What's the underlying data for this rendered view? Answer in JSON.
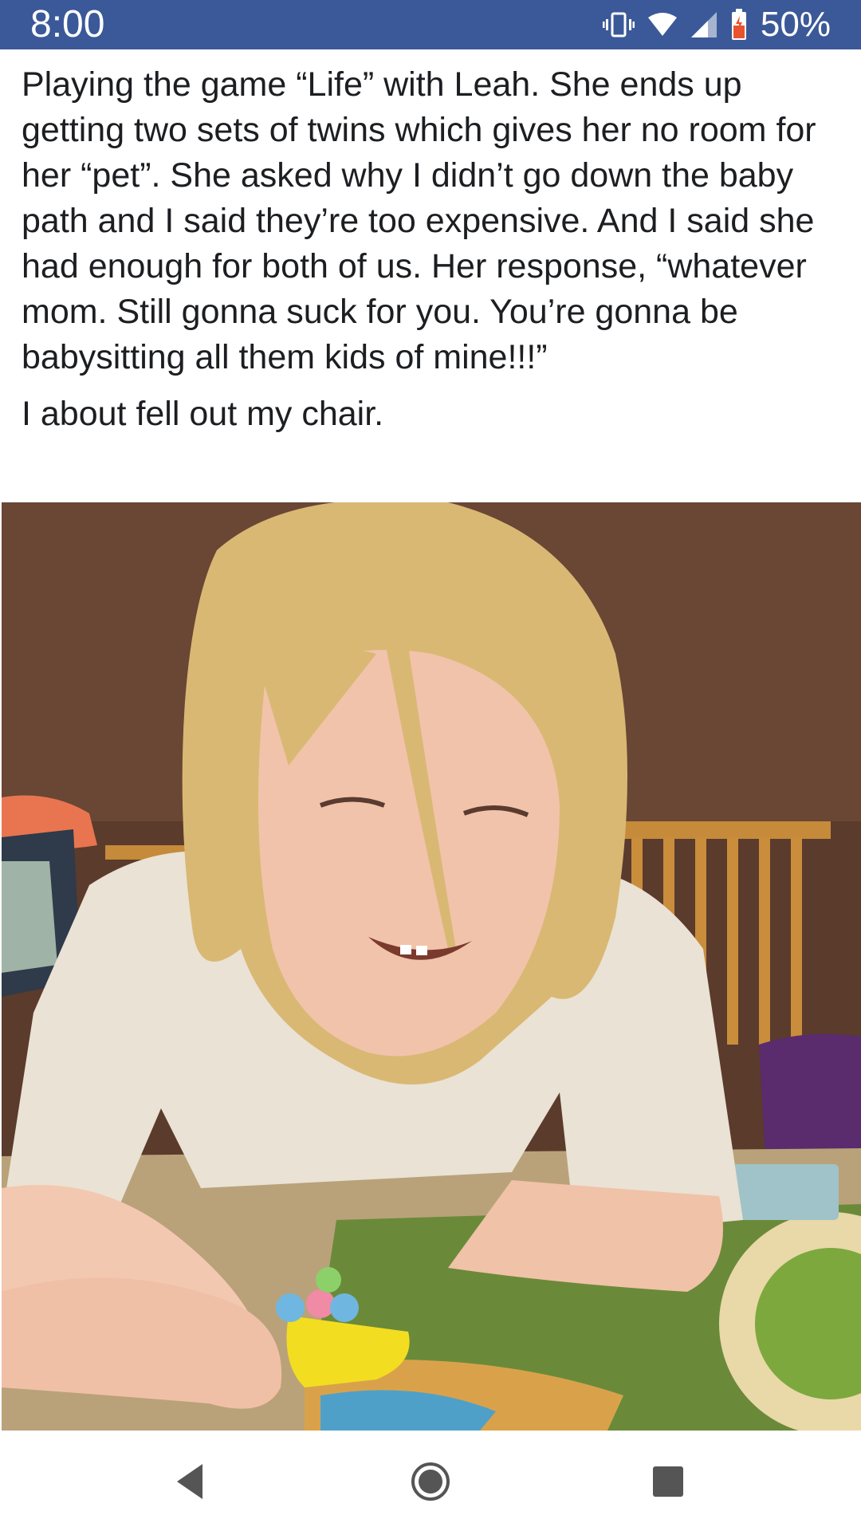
{
  "status_bar": {
    "time": "8:00",
    "battery_percent": "50%",
    "icons": [
      "vibrate-icon",
      "wifi-icon",
      "cell-signal-icon",
      "battery-icon"
    ],
    "background_color": "#3b5998"
  },
  "post": {
    "paragraphs": [
      "Playing the game “Life” with Leah. She ends up getting two sets of twins which gives her no room for her “pet”. She asked why I didn’t go down the baby path and I said they’re too expensive. And I said she had enough for both of us. Her response, “whatever mom. Still gonna suck for you. You’re gonna be babysitting all them kids of mine!!!”",
      "I about fell out my chair."
    ]
  },
  "nav_bar": {
    "buttons": [
      "back-icon",
      "home-icon",
      "recents-icon"
    ]
  }
}
